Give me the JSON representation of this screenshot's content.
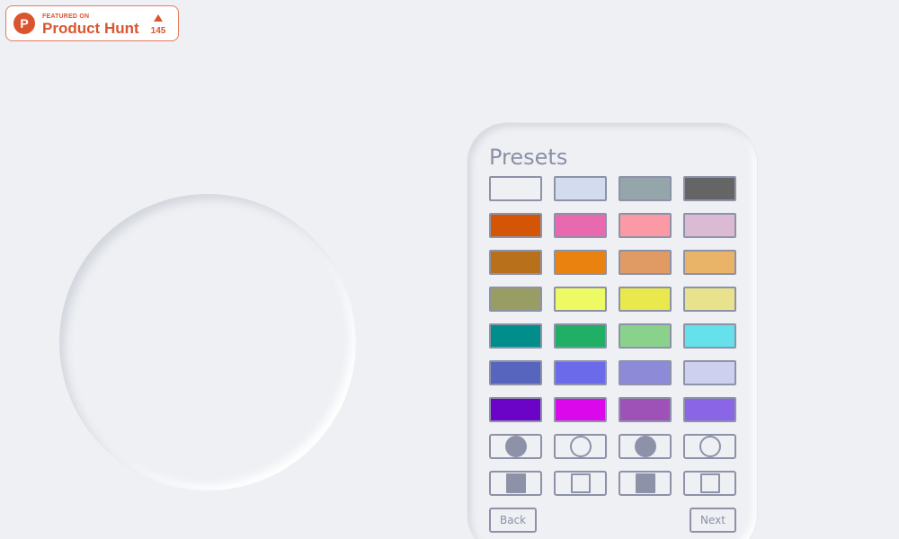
{
  "badge": {
    "featured_label": "FEATURED ON",
    "name": "Product Hunt",
    "logo_letter": "P",
    "vote_count": "145",
    "brand_color": "#da552f"
  },
  "presets": {
    "title": "Presets",
    "swatches": [
      "#eef0f4",
      "#d3dcee",
      "#94a6aa",
      "#656565",
      "#d45505",
      "#e969b1",
      "#fb9aa4",
      "#dbbbd4",
      "#b8701a",
      "#ea820f",
      "#e09b64",
      "#e9b368",
      "#989d64",
      "#eefa64",
      "#e9e84c",
      "#e9e28d",
      "#008e8a",
      "#20af64",
      "#8ad28c",
      "#64e1ea",
      "#5865bf",
      "#6a6aeb",
      "#8d8ad7",
      "#cdd0ef",
      "#6c04c8",
      "#dc08ec",
      "#9e52b8",
      "#8a65e6"
    ],
    "shape_buttons": [
      "circle-filled",
      "circle-outline",
      "circle-filled",
      "circle-outline",
      "square-filled",
      "square-outline",
      "square-filled",
      "square-outline"
    ],
    "back_label": "Back",
    "next_label": "Next",
    "accent_color": "#8d92a8"
  }
}
